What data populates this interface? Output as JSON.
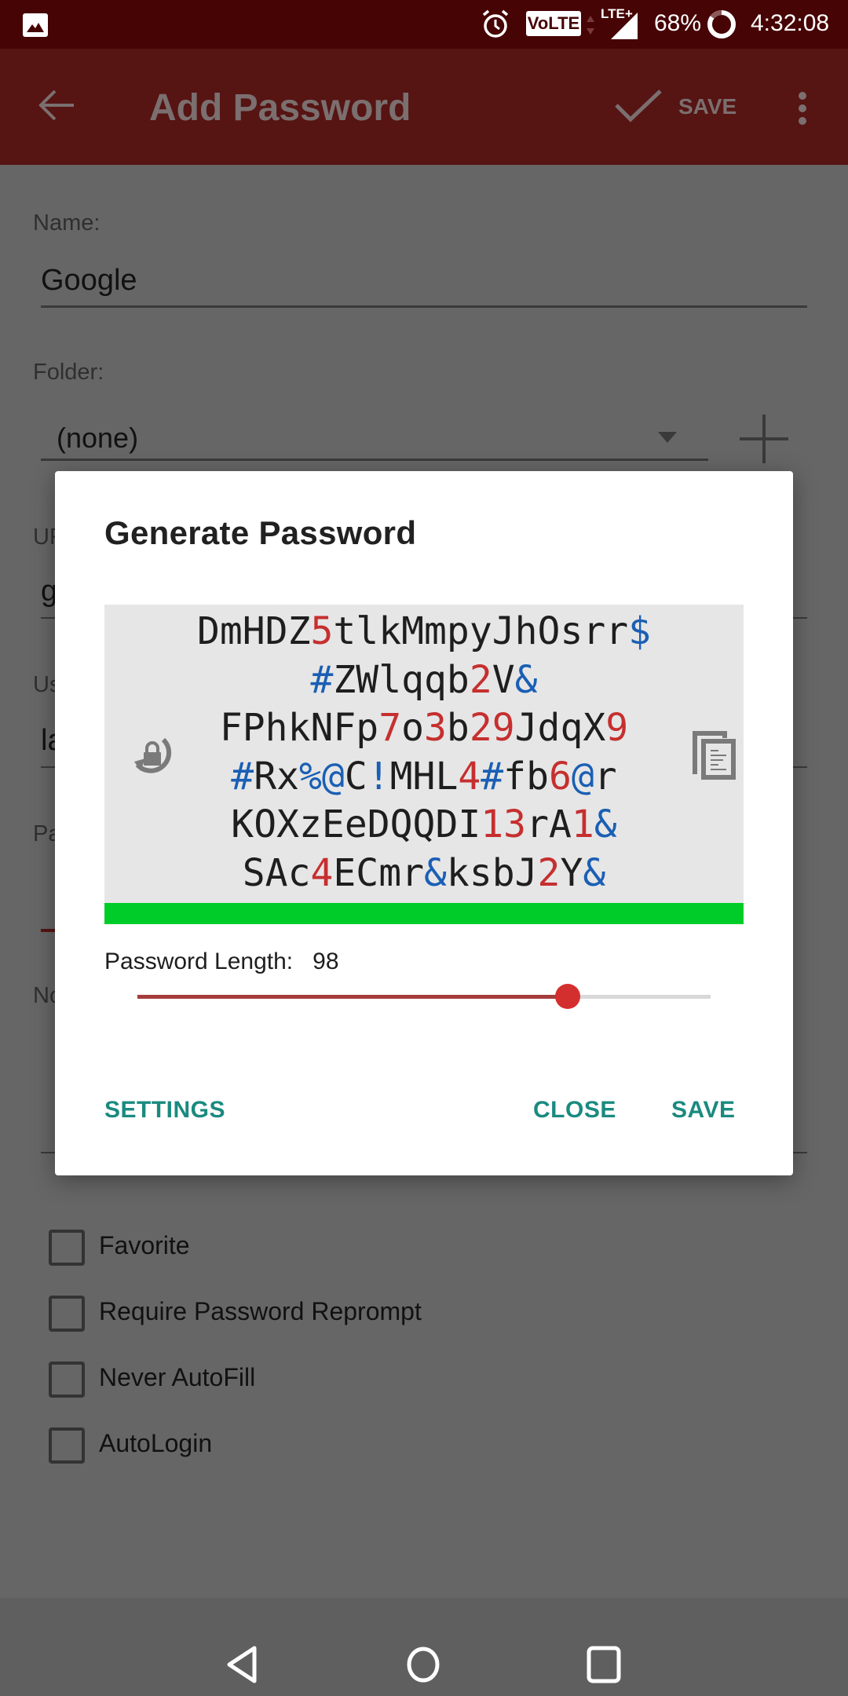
{
  "status_bar": {
    "battery_percent": "68%",
    "time": "4:32:08",
    "network_badge": "VoLTE",
    "network_type": "LTE+",
    "icons": [
      "gallery-icon",
      "alarm-icon",
      "volte-icon",
      "signal-icon",
      "battery-icon"
    ]
  },
  "app_bar": {
    "title": "Add Password",
    "save_label": "SAVE",
    "icons": [
      "back-arrow-icon",
      "checkmark-icon",
      "more-vert-icon"
    ]
  },
  "form": {
    "name_label": "Name:",
    "name_value": "Google",
    "folder_label": "Folder:",
    "folder_value": "(none)",
    "url_label_partial": "UR",
    "url_value_partial": "g",
    "username_label_partial": "Us",
    "username_value_partial": "la",
    "password_label_partial": "Pa",
    "notes_label_partial": "No",
    "checkboxes": [
      {
        "label": "Favorite",
        "checked": false
      },
      {
        "label": "Require Password Reprompt",
        "checked": false
      },
      {
        "label": "Never AutoFill",
        "checked": false
      },
      {
        "label": "AutoLogin",
        "checked": false
      }
    ]
  },
  "dialog": {
    "title": "Generate Password",
    "password_lines": [
      "DmHDZ5tlkMmpyJhOsrr$",
      "#ZWlqqb2V&",
      "FPhkNFp7o3b29JdqX9",
      "#Rx%@C!MHL4#fb6@r",
      "KOXzEeDQQDI13rA1&",
      "SAc4ECmr&ksbJ2Y&"
    ],
    "strength_color": "#00cc29",
    "digit_color": "#c62f2f",
    "symbol_color": "#1a5fb4",
    "length_label": "Password Length:",
    "length_value": "98",
    "slider_fraction": 0.75,
    "buttons": {
      "settings": "SETTINGS",
      "close": "CLOSE",
      "save": "SAVE"
    },
    "accent_color": "#1a8a80"
  },
  "nav_bar": {
    "icons": [
      "back-icon",
      "home-icon",
      "recents-icon"
    ]
  }
}
